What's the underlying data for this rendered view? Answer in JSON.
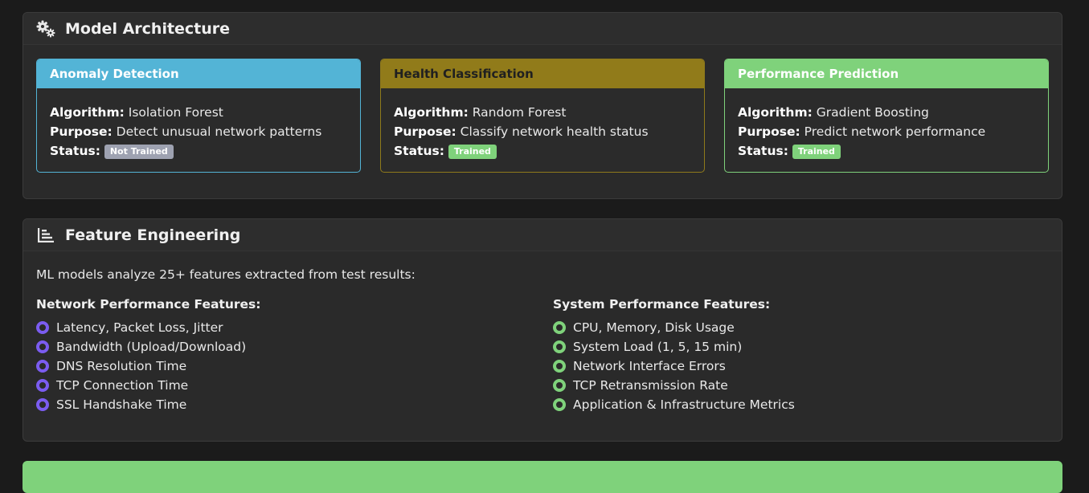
{
  "architecture": {
    "title": "Model Architecture",
    "models": [
      {
        "name": "Anomaly Detection",
        "algorithm_label": "Algorithm:",
        "algorithm": "Isolation Forest",
        "purpose_label": "Purpose:",
        "purpose": "Detect unusual network patterns",
        "status_label": "Status:",
        "status": "Not Trained",
        "accent": "#53b4d6"
      },
      {
        "name": "Health Classification",
        "algorithm_label": "Algorithm:",
        "algorithm": "Random Forest",
        "purpose_label": "Purpose:",
        "purpose": "Classify network health status",
        "status_label": "Status:",
        "status": "Trained",
        "accent": "#917b1a"
      },
      {
        "name": "Performance Prediction",
        "algorithm_label": "Algorithm:",
        "algorithm": "Gradient Boosting",
        "purpose_label": "Purpose:",
        "purpose": "Predict network performance",
        "status_label": "Status:",
        "status": "Trained",
        "accent": "#7fd27b"
      }
    ]
  },
  "features": {
    "title": "Feature Engineering",
    "intro": "ML models analyze 25+ features extracted from test results:",
    "network": {
      "heading": "Network Performance Features:",
      "items": [
        "Latency, Packet Loss, Jitter",
        "Bandwidth (Upload/Download)",
        "DNS Resolution Time",
        "TCP Connection Time",
        "SSL Handshake Time"
      ]
    },
    "system": {
      "heading": "System Performance Features:",
      "items": [
        "CPU, Memory, Disk Usage",
        "System Load (1, 5, 15 min)",
        "Network Interface Errors",
        "TCP Retransmission Rate",
        "Application & Infrastructure Metrics"
      ]
    }
  },
  "next_card": {
    "accent": "#7fd27b"
  }
}
